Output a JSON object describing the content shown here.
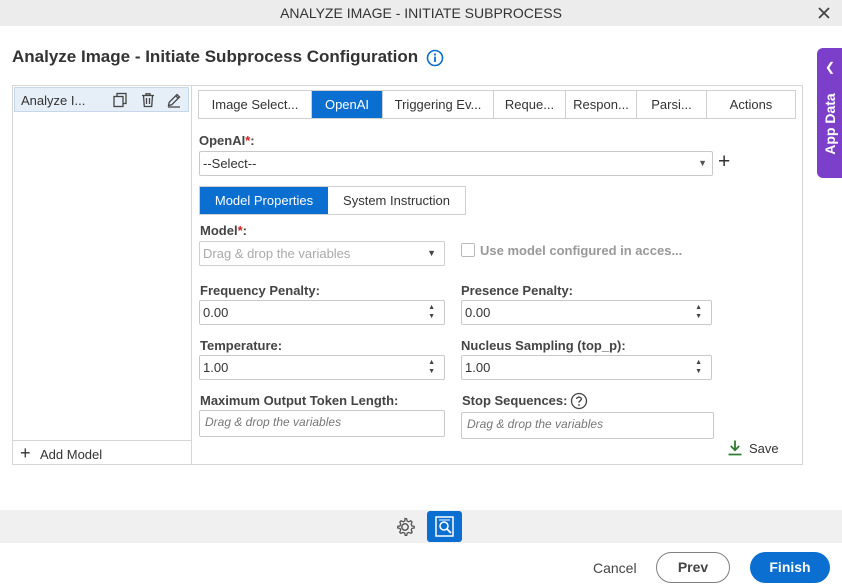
{
  "window": {
    "title": "ANALYZE IMAGE - INITIATE SUBPROCESS"
  },
  "page": {
    "title": "Analyze Image - Initiate Subprocess Configuration"
  },
  "app_data": {
    "label": "App Data"
  },
  "left_panel": {
    "items": [
      {
        "label": "Analyze I..."
      }
    ],
    "add_label": "Add Model"
  },
  "tabs": [
    {
      "label": "Image Select..."
    },
    {
      "label": "OpenAI"
    },
    {
      "label": "Triggering Ev..."
    },
    {
      "label": "Reque..."
    },
    {
      "label": "Respon..."
    },
    {
      "label": "Parsi..."
    },
    {
      "label": "Actions"
    }
  ],
  "active_tab": "OpenAI",
  "openai": {
    "label": "OpenAI",
    "required_mark": "*",
    "colon": ":",
    "value": "--Select--"
  },
  "subtabs": [
    {
      "label": "Model Properties"
    },
    {
      "label": "System Instruction"
    }
  ],
  "model": {
    "label": "Model",
    "required_mark": "*",
    "colon": ":",
    "placeholder": "Drag & drop the variables",
    "use_configured_label": "Use model configured in acces..."
  },
  "fields": {
    "frequency_penalty": {
      "label": "Frequency Penalty:",
      "value": "0.00"
    },
    "presence_penalty": {
      "label": "Presence Penalty:",
      "value": "0.00"
    },
    "temperature": {
      "label": "Temperature:",
      "value": "1.00"
    },
    "nucleus_sampling": {
      "label": "Nucleus Sampling (top_p):",
      "value": "1.00"
    },
    "max_output_tokens": {
      "label": "Maximum Output Token Length:",
      "placeholder": "Drag & drop the variables"
    },
    "stop_sequences": {
      "label": "Stop Sequences:",
      "placeholder": "Drag & drop the variables"
    }
  },
  "save_label": "Save",
  "footer": {
    "cancel": "Cancel",
    "prev": "Prev",
    "finish": "Finish"
  },
  "colors": {
    "accent": "#0a6fd1",
    "app_data": "#7b3fc9",
    "required": "#d21f1f",
    "save_icon": "#2e7d32"
  }
}
